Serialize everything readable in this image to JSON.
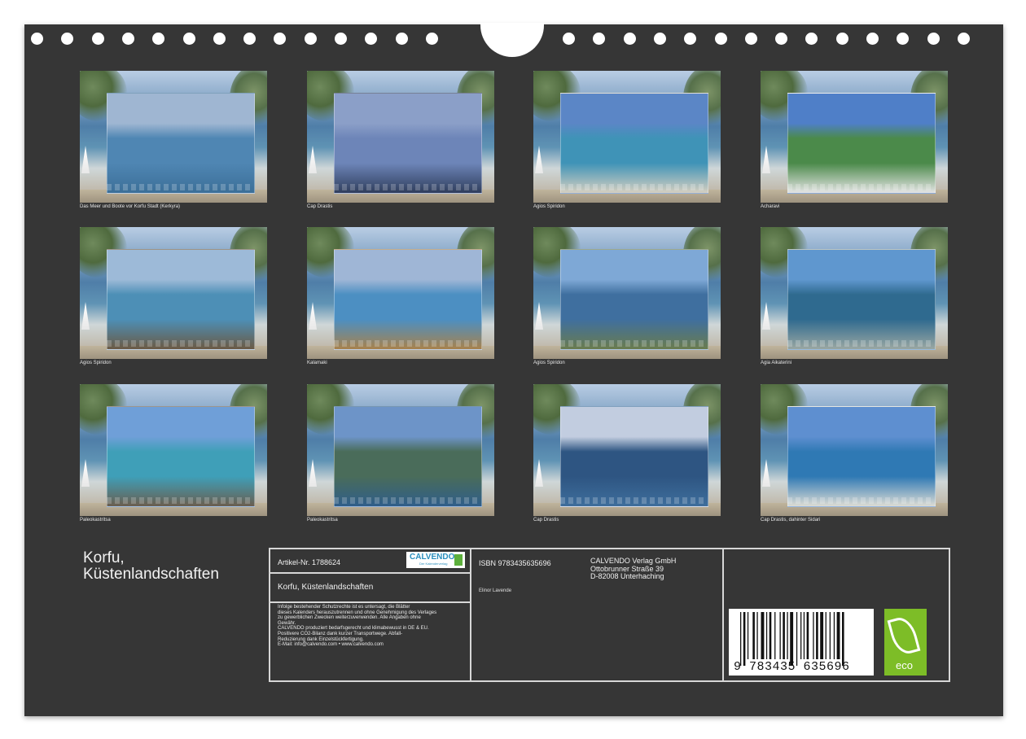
{
  "calendar": {
    "title_line1": "Korfu,",
    "title_line2": "Küstenlandschaften"
  },
  "photos": [
    {
      "caption": "Das Meer und Boote vor Korfu Stadt (Kerkyra)",
      "palette": [
        "#9fb6d2",
        "#4f86b3",
        "#3c6f98"
      ]
    },
    {
      "caption": "Cap Drastis",
      "palette": [
        "#8b9fc8",
        "#6d85b8",
        "#2f3d5c"
      ]
    },
    {
      "caption": "Agios Spiridon",
      "palette": [
        "#5b86c6",
        "#3f93b7",
        "#d5cfc0"
      ]
    },
    {
      "caption": "Acharavi",
      "palette": [
        "#4f7fc8",
        "#4b8a4a",
        "#e4e4e4"
      ]
    },
    {
      "caption": "Agios Spiridon",
      "palette": [
        "#9dbad8",
        "#4d8fb6",
        "#6b5a44"
      ]
    },
    {
      "caption": "Kalamaki",
      "palette": [
        "#9fb6d6",
        "#4c8fc2",
        "#a8824c"
      ]
    },
    {
      "caption": "Agios Spiridon",
      "palette": [
        "#7ea8d6",
        "#3f6f9f",
        "#6a7c4e"
      ]
    },
    {
      "caption": "Agia Aikaterini",
      "palette": [
        "#5f97cf",
        "#2f6a8f",
        "#9aa7a2"
      ]
    },
    {
      "caption": "Paleokastritsa",
      "palette": [
        "#6f9fd8",
        "#3f9fb8",
        "#6a5e4f"
      ]
    },
    {
      "caption": "Paleokastritsa",
      "palette": [
        "#6d94c8",
        "#4a6c5a",
        "#2f5e8a"
      ]
    },
    {
      "caption": "Cap Drastis",
      "palette": [
        "#c2cde0",
        "#2e5582",
        "#3e6e9c"
      ]
    },
    {
      "caption": "Cap Drastis, dahinter Sidari",
      "palette": [
        "#5e8fd0",
        "#2f79b4",
        "#dcdcd4"
      ]
    }
  ],
  "info": {
    "artikel": "Artikel-Nr. 1788624",
    "logo_word": "CALVENDO",
    "logo_tag": "Der Kalenderverlag",
    "book_title": "Korfu, Küstenlandschaften",
    "legal_lines": [
      "Infolge bestehender Schutzrechte ist es untersagt, die Blätter",
      "dieses Kalenders herauszutrennen und ohne Genehmigung des Verlages",
      "zu gewerblichen Zwecken weiterzuverwenden. Alle Angaben ohne",
      "Gewähr.",
      "CALVENDO produziert bedarfsgerecht und klimabewusst in DE & EU.",
      "Positivere CO2-Bilanz dank kurzer Transportwege. Abfall-",
      "Reduzierung dank Einzelstückfertigung.",
      "E-Mail: info@calvendo.com • www.calvendo.com"
    ],
    "isbn": "ISBN 9783435635696",
    "author": "Elinor Lavende",
    "publisher_lines": [
      "CALVENDO Verlag GmbH",
      "Ottobrunner Straße 39",
      "D-82008 Unterhaching"
    ],
    "barcode_digits": "9 783435 635696",
    "eco_label": "eco"
  },
  "colors": {
    "background": "#363636",
    "border": "#d7d7d7",
    "eco_green": "#7dbd27",
    "logo_blue": "#2a8fbd"
  }
}
